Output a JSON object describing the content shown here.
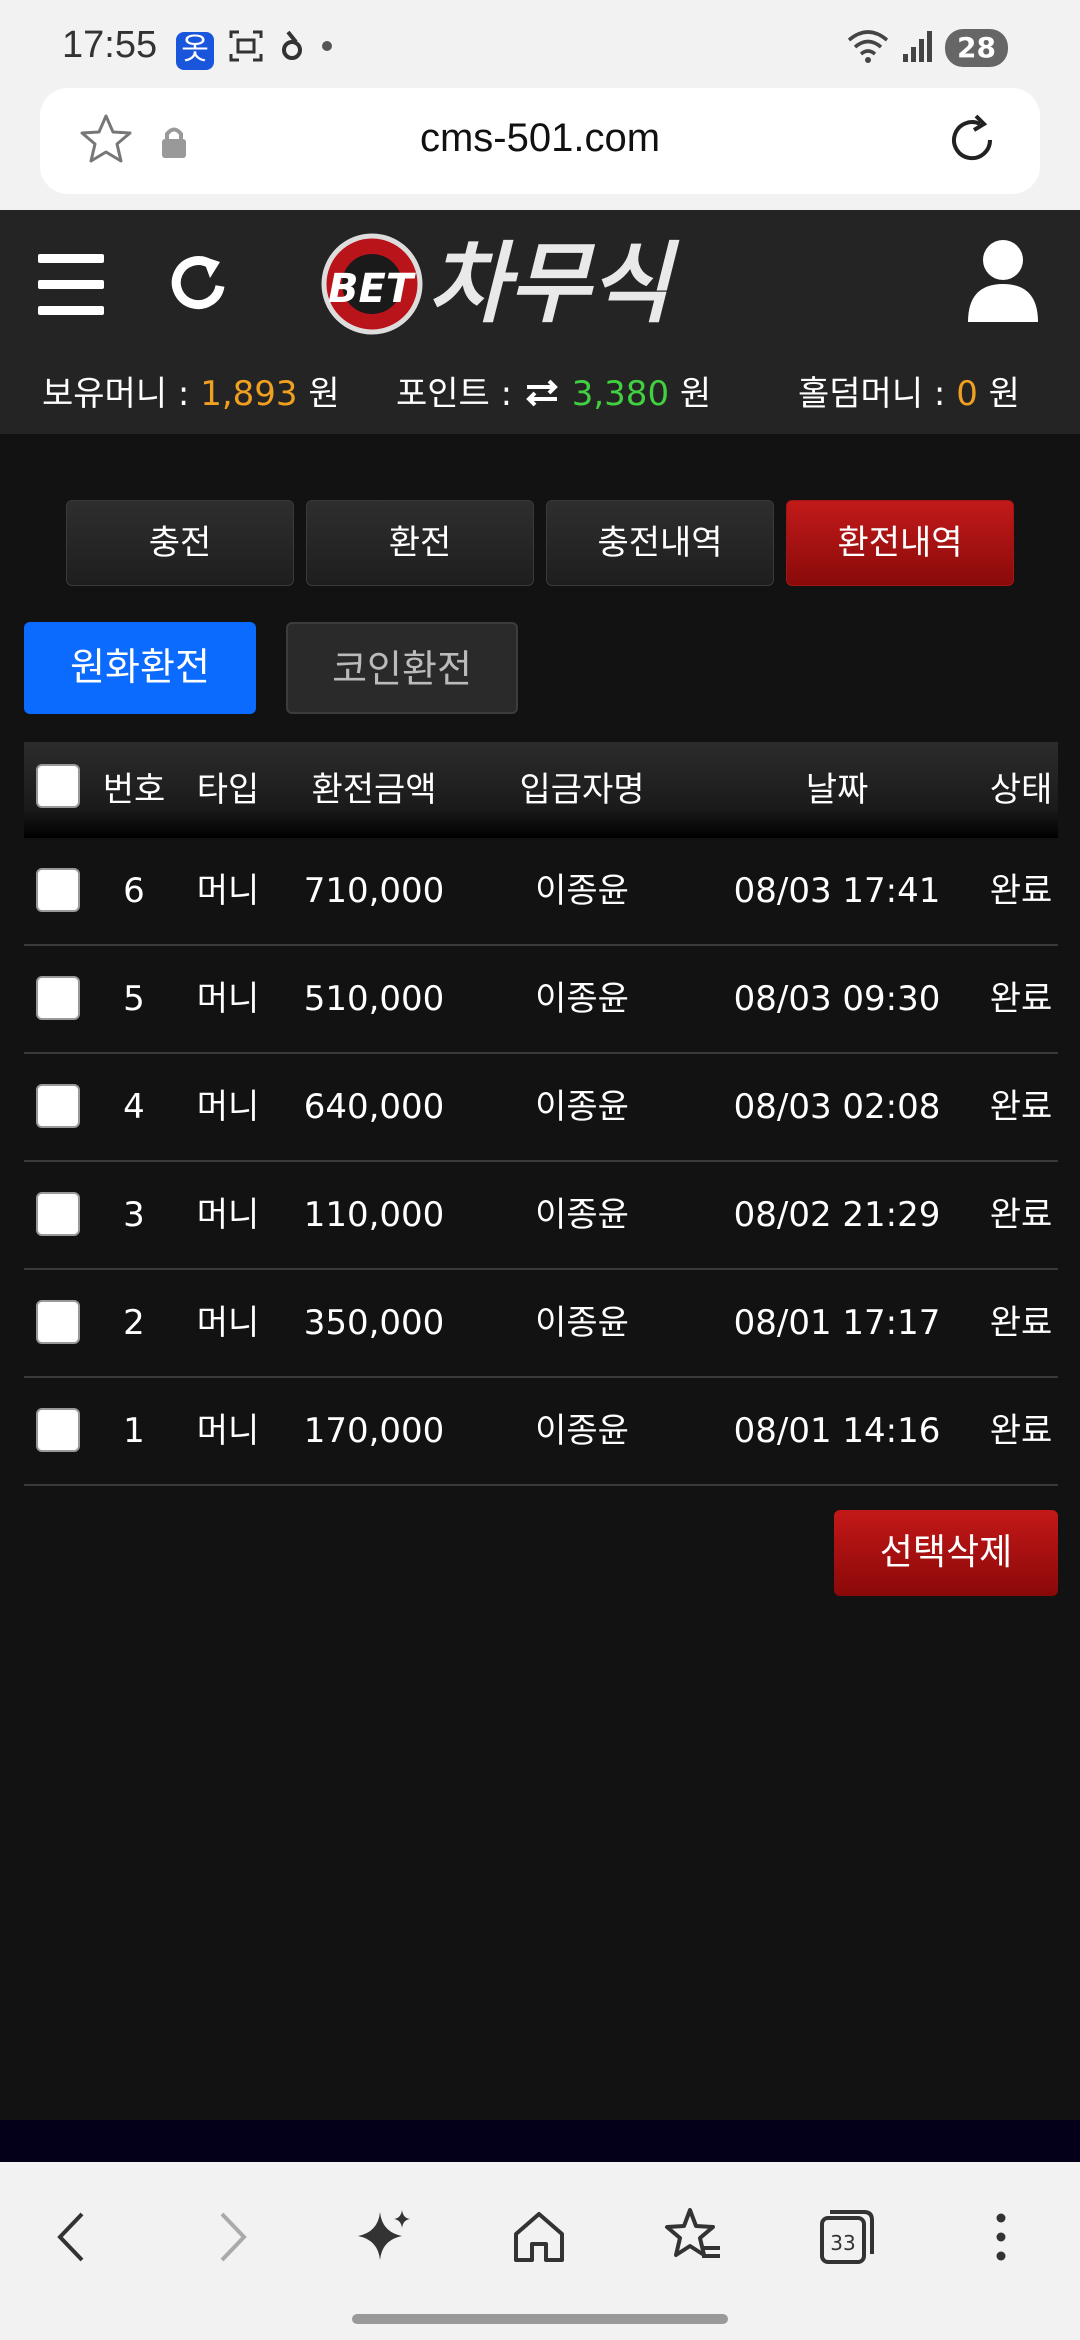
{
  "status": {
    "time": "17:55",
    "notification_badge": "옷",
    "battery": "28"
  },
  "browser": {
    "url": "cms-501.com"
  },
  "header": {
    "logo_text": "BET 차무식",
    "balances": {
      "money_label": "보유머니 : ",
      "money_value": "1,893",
      "money_unit": " 원",
      "point_label": "포인트 : ",
      "point_value": "3,380",
      "point_unit": " 원",
      "holdem_label": "홀덤머니 : ",
      "holdem_value": "0",
      "holdem_unit": " 원"
    }
  },
  "tabs": [
    {
      "label": "충전"
    },
    {
      "label": "환전"
    },
    {
      "label": "충전내역"
    },
    {
      "label": "환전내역"
    }
  ],
  "subtabs": [
    {
      "label": "원화환전"
    },
    {
      "label": "코인환전"
    }
  ],
  "table": {
    "headers": {
      "no": "번호",
      "type": "타입",
      "amount": "환전금액",
      "depositor": "입금자명",
      "date": "날짜",
      "status": "상태"
    },
    "rows": [
      {
        "no": "6",
        "type": "머니",
        "amount": "710,000",
        "depositor": "이종윤",
        "date": "08/03 17:41",
        "status": "완료"
      },
      {
        "no": "5",
        "type": "머니",
        "amount": "510,000",
        "depositor": "이종윤",
        "date": "08/03 09:30",
        "status": "완료"
      },
      {
        "no": "4",
        "type": "머니",
        "amount": "640,000",
        "depositor": "이종윤",
        "date": "08/03 02:08",
        "status": "완료"
      },
      {
        "no": "3",
        "type": "머니",
        "amount": "110,000",
        "depositor": "이종윤",
        "date": "08/02 21:29",
        "status": "완료"
      },
      {
        "no": "2",
        "type": "머니",
        "amount": "350,000",
        "depositor": "이종윤",
        "date": "08/01 17:17",
        "status": "완료"
      },
      {
        "no": "1",
        "type": "머니",
        "amount": "170,000",
        "depositor": "이종윤",
        "date": "08/01 14:16",
        "status": "완료"
      }
    ]
  },
  "delete_button": "선택삭제",
  "bottom_nav": {
    "tab_count": "33"
  },
  "colors": {
    "accent_red": "#a31515",
    "accent_blue": "#0b6bff",
    "money": "#f0a020",
    "point": "#40d040"
  }
}
